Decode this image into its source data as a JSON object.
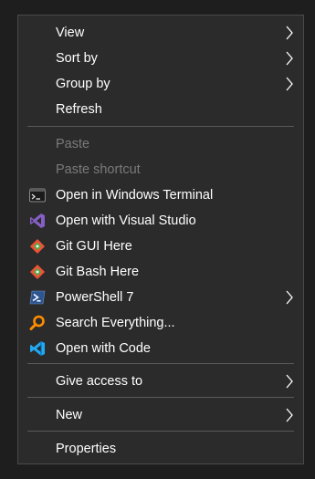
{
  "menu": {
    "items": {
      "view": {
        "label": "View"
      },
      "sort_by": {
        "label": "Sort by"
      },
      "group_by": {
        "label": "Group by"
      },
      "refresh": {
        "label": "Refresh"
      },
      "paste": {
        "label": "Paste"
      },
      "paste_shortcut": {
        "label": "Paste shortcut"
      },
      "terminal": {
        "label": "Open in Windows Terminal",
        "icon": "windows-terminal-icon"
      },
      "visual_studio": {
        "label": "Open with Visual Studio",
        "icon": "visual-studio-icon"
      },
      "git_gui": {
        "label": "Git GUI Here",
        "icon": "git-gui-icon"
      },
      "git_bash": {
        "label": "Git Bash Here",
        "icon": "git-bash-icon"
      },
      "powershell": {
        "label": "PowerShell 7",
        "icon": "powershell-icon"
      },
      "search_everything": {
        "label": "Search Everything...",
        "icon": "search-everything-icon"
      },
      "vscode": {
        "label": "Open with Code",
        "icon": "vscode-icon"
      },
      "give_access": {
        "label": "Give access to"
      },
      "new": {
        "label": "New"
      },
      "properties": {
        "label": "Properties"
      }
    }
  },
  "colors": {
    "background": "#2b2b2b",
    "text": "#ffffff",
    "disabled_text": "#7a7a7a",
    "separator": "#5a5a5a",
    "visual_studio": "#865fc5",
    "git": "#f05133",
    "powershell": "#2c5591",
    "search_everything": "#ff8c00",
    "vscode": "#23a9f2"
  }
}
